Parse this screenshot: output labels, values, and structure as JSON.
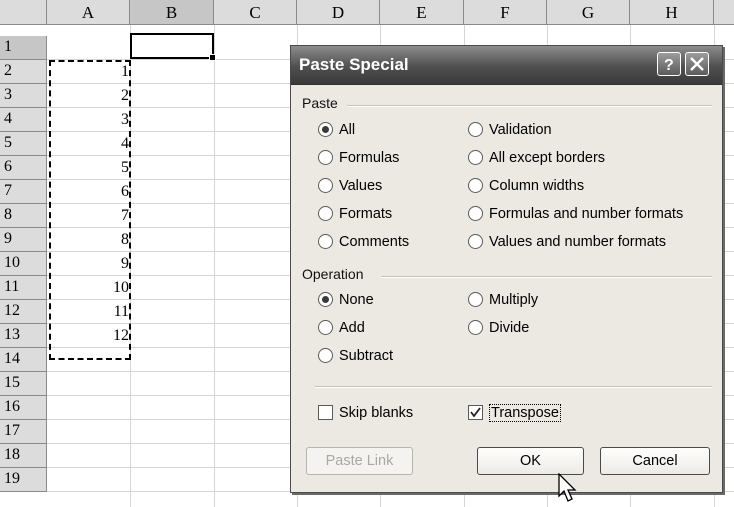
{
  "spreadsheet": {
    "columns": [
      "A",
      "B",
      "C",
      "D",
      "E",
      "F",
      "G",
      "H"
    ],
    "rows": [
      "1",
      "2",
      "3",
      "4",
      "5",
      "6",
      "7",
      "8",
      "9",
      "10",
      "11",
      "12",
      "13",
      "14",
      "15",
      "16",
      "17",
      "18",
      "19"
    ],
    "col_a_values": [
      "1",
      "2",
      "3",
      "4",
      "5",
      "6",
      "7",
      "8",
      "9",
      "10",
      "11",
      "12"
    ]
  },
  "dialog": {
    "title": "Paste Special",
    "help_icon": "question-icon",
    "close_icon": "close-icon",
    "paste_group_label": "Paste",
    "paste_options": [
      {
        "label": "All",
        "checked": true
      },
      {
        "label": "Formulas",
        "checked": false
      },
      {
        "label": "Values",
        "checked": false
      },
      {
        "label": "Formats",
        "checked": false
      },
      {
        "label": "Comments",
        "checked": false
      },
      {
        "label": "Validation",
        "checked": false
      },
      {
        "label": "All except borders",
        "checked": false
      },
      {
        "label": "Column widths",
        "checked": false
      },
      {
        "label": "Formulas and number formats",
        "checked": false
      },
      {
        "label": "Values and number formats",
        "checked": false
      }
    ],
    "operation_group_label": "Operation",
    "operation_options": [
      {
        "label": "None",
        "checked": true
      },
      {
        "label": "Add",
        "checked": false
      },
      {
        "label": "Subtract",
        "checked": false
      },
      {
        "label": "Multiply",
        "checked": false
      },
      {
        "label": "Divide",
        "checked": false
      }
    ],
    "skip_blanks": {
      "label": "Skip blanks",
      "checked": false
    },
    "transpose": {
      "label": "Transpose",
      "checked": true
    },
    "buttons": {
      "paste_link": "Paste Link",
      "ok": "OK",
      "cancel": "Cancel"
    }
  }
}
